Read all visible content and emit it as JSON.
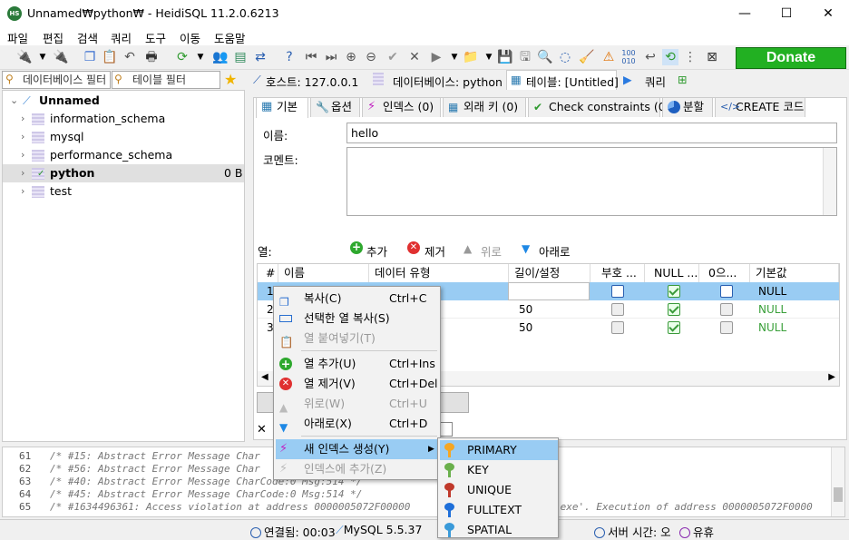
{
  "title": "Unnamed₩python₩ - HeidiSQL 11.2.0.6213",
  "app_icon": "HS",
  "window_controls": {
    "minimize": "—",
    "maximize": "☐",
    "close": "✕"
  },
  "menu": [
    "파일",
    "편집",
    "검색",
    "쿼리",
    "도구",
    "이동",
    "도움말"
  ],
  "donate": "Donate",
  "filters": {
    "db": "데이터베이스 필터",
    "table": "테이블 필터"
  },
  "tree": {
    "root": "Unnamed",
    "items": [
      {
        "label": "information_schema",
        "size": ""
      },
      {
        "label": "mysql",
        "size": ""
      },
      {
        "label": "performance_schema",
        "size": ""
      },
      {
        "label": "python",
        "size": "0 B"
      },
      {
        "label": "test",
        "size": ""
      }
    ]
  },
  "breadcrumb": {
    "host": "호스트: 127.0.0.1",
    "db": "데이터베이스: python",
    "table": "테이블: [Untitled]",
    "query": "쿼리"
  },
  "tabs": [
    "기본",
    "옵션",
    "인덱스 (0)",
    "외래 키 (0)",
    "Check constraints (0)",
    "분할",
    "CREATE 코드"
  ],
  "form": {
    "name_label": "이름:",
    "name_value": "hello",
    "comment_label": "코멘트:"
  },
  "columns_bar": {
    "label": "열:",
    "add": "추가",
    "remove": "제거",
    "up": "위로",
    "down": "아래로"
  },
  "grid": {
    "headers": [
      "#",
      "이름",
      "데이터 유형",
      "길이/설정",
      "부호 ...",
      "NULL ...",
      "0으...",
      "기본값"
    ],
    "rows": [
      {
        "num": "1",
        "len": "",
        "default": "NULL"
      },
      {
        "num": "2",
        "len": "50",
        "default": "NULL"
      },
      {
        "num": "3",
        "len": "50",
        "default": "NULL"
      }
    ]
  },
  "save_fragment": "장",
  "context_menu": [
    {
      "label": "복사(C)",
      "key": "Ctrl+C",
      "disabled": false
    },
    {
      "label": "선택한 열 복사(S)",
      "key": "",
      "disabled": false
    },
    {
      "label": "열 붙여넣기(T)",
      "key": "",
      "disabled": true
    },
    {
      "label": "열 추가(U)",
      "key": "Ctrl+Ins",
      "disabled": false
    },
    {
      "label": "열 제거(V)",
      "key": "Ctrl+Del",
      "disabled": false
    },
    {
      "label": "위로(W)",
      "key": "Ctrl+U",
      "disabled": true
    },
    {
      "label": "아래로(X)",
      "key": "Ctrl+D",
      "disabled": false
    },
    {
      "label": "새 인덱스 생성(Y)",
      "key": "",
      "disabled": false
    },
    {
      "label": "인덱스에 추가(Z)",
      "key": "",
      "disabled": true
    }
  ],
  "submenu": [
    "PRIMARY",
    "KEY",
    "UNIQUE",
    "FULLTEXT",
    "SPATIAL"
  ],
  "key_colors": [
    "#f5a623",
    "#6ab04c",
    "#c0392b",
    "#1e6fd9",
    "#3a9ad9"
  ],
  "log": [
    {
      "n": "61",
      "t": "/* #15: Abstract Error Message Char"
    },
    {
      "n": "62",
      "t": "/* #56: Abstract Error Message Char"
    },
    {
      "n": "63",
      "t": "/* #40: Abstract Error Message CharCode:0 Msg:514 */"
    },
    {
      "n": "64",
      "t": "/* #45: Abstract Error Message CharCode:0 Msg:514 */"
    },
    {
      "n": "65",
      "t": "/* #1634496361: Access violation at address 0000005072F00000"
    }
  ],
  "log_tail": ".exe'. Execution of address 0000005072F0000",
  "status": {
    "connected": "연결됨: 00:03",
    "mysql": "MySQL 5.5.37",
    "server_time": "서버 시간: 오",
    "idle": "유휴"
  }
}
